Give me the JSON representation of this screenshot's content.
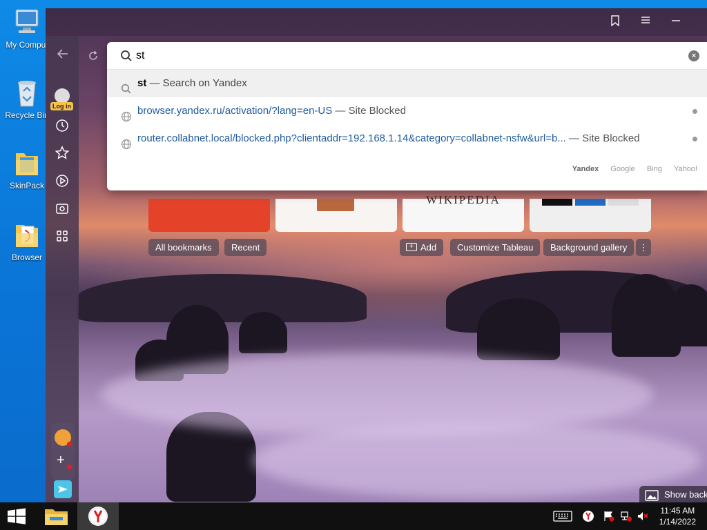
{
  "desktop": {
    "icons": [
      {
        "label": "My Comput",
        "icon": "computer-icon"
      },
      {
        "label": "Recycle Bin",
        "icon": "recycle-bin-icon"
      },
      {
        "label": "SkinPack",
        "icon": "folder-icon"
      },
      {
        "label": "Browser",
        "icon": "folder-icon"
      }
    ]
  },
  "browser": {
    "sidebar": {
      "login_label": "Log in"
    },
    "omnibox": {
      "value": "st",
      "suggestions": [
        {
          "query": "st",
          "suffix": " — Search on Yandex",
          "type": "search"
        },
        {
          "url": "browser.yandex.ru/activation/?lang=en-US",
          "suffix": " — Site Blocked",
          "type": "site"
        },
        {
          "url": "router.collabnet.local/blocked.php?clientaddr=192.168.1.14&category=collabnet-nsfw&url=b...",
          "suffix": " — Site Blocked",
          "type": "site"
        }
      ],
      "engines": [
        "Yandex",
        "Google",
        "Bing",
        "Yahoo!"
      ]
    },
    "tableau": {
      "tile_text": "WIKIPEDIA",
      "buttons": {
        "all_bookmarks": "All bookmarks",
        "recent": "Recent",
        "add": "Add",
        "customize": "Customize Tableau",
        "background_gallery": "Background gallery"
      },
      "show_background": "Show back"
    }
  },
  "taskbar": {
    "time": "11:45 AM",
    "date": "1/14/2022"
  }
}
